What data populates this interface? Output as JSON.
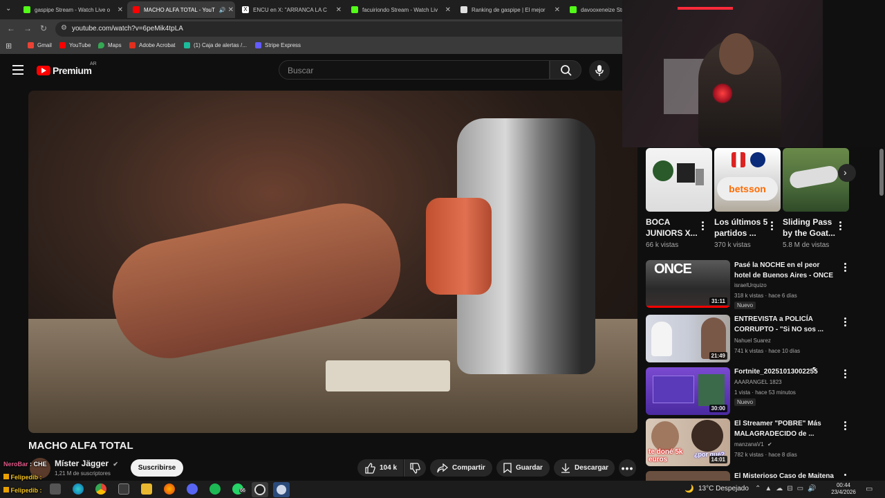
{
  "browser": {
    "tabs": [
      {
        "label": "gaspipe Stream - Watch Live o",
        "color": "#53fc18",
        "active": false
      },
      {
        "label": "MACHO ALFA TOTAL - YouT",
        "color": "#ff0000",
        "active": true
      },
      {
        "label": "ENCU en X: \"ARRANCA LA C",
        "color": "#ffffff",
        "active": false
      },
      {
        "label": "facuiriondo Stream - Watch Liv",
        "color": "#53fc18",
        "active": false
      },
      {
        "label": "Ranking de gaspipe | El mejor",
        "color": "#e0e0e0",
        "active": false
      },
      {
        "label": "davooxeneize Str",
        "color": "#53fc18",
        "active": false
      }
    ],
    "url": "youtube.com/watch?v=6peMik4tpLA",
    "bookmarks": [
      {
        "label": "Gmail",
        "color": "#ea4335"
      },
      {
        "label": "YouTube",
        "color": "#ff0000"
      },
      {
        "label": "Maps",
        "color": "#34a853"
      },
      {
        "label": "Adobe Acrobat",
        "color": "#e02f1e"
      },
      {
        "label": "(1) Caja de alertas /...",
        "color": "#1bbc9b"
      },
      {
        "label": "Stripe Express",
        "color": "#635bff"
      }
    ]
  },
  "youtube": {
    "logo_text": "Premium",
    "region": "AR",
    "search_placeholder": "Buscar"
  },
  "video": {
    "title": "MACHO ALFA TOTAL",
    "channel": "Míster Jägger",
    "subscribers": "1,21 M de suscriptores",
    "subscribe_label": "Suscribirse",
    "likes": "104 k",
    "share_label": "Compartir",
    "save_label": "Guardar",
    "download_label": "Descargar"
  },
  "shorts": [
    {
      "title": "BOCA JUNIORS X...",
      "views": "66 k vistas"
    },
    {
      "title": "Los últimos 5 partidos ...",
      "views": "370 k vistas",
      "thumb_text": "betsson"
    },
    {
      "title": "Sliding Pass by the Goat...",
      "views": "5.8 M de vistas"
    }
  ],
  "recommendations": [
    {
      "title": "Pasé la NOCHE en el peor hotel de Buenos Aires - ONCE",
      "channel": "israelUrquizo",
      "meta": "318 k vistas · hace 6 días",
      "duration": "31:11",
      "badge": "Nuevo",
      "thumb_text": "ONCE"
    },
    {
      "title": "ENTREVISTA a POLICÍA CORRUPTO - \"Si NO sos ...",
      "channel": "Nahuel Suarez",
      "meta": "741 k vistas · hace 10 días",
      "duration": "21:49",
      "badge": ""
    },
    {
      "title": "Fortnite_20251013002255",
      "channel": "AAARANGEL 1823",
      "meta": "1 vista · hace 53 minutos",
      "duration": "30:00",
      "badge": "Nuevo"
    },
    {
      "title": "El Streamer \"POBRE\" Más MALAGRADECIDO de ...",
      "channel": "manzanaV1",
      "meta": "782 k vistas · hace 8 días",
      "duration": "14:01",
      "badge": "",
      "thumb_text": "te doné 5k euros",
      "thumb_text2": "¿por qué?"
    },
    {
      "title": "El Misterioso Caso de Maitena",
      "channel": "",
      "meta": "",
      "duration": "",
      "badge": ""
    }
  ],
  "chat": [
    {
      "user": "NeroBar",
      "text": "CHE",
      "color": "#e05a8a"
    },
    {
      "user": "Felipedib :",
      "text": "",
      "color": "#f0c020"
    },
    {
      "user": "Felipedib :",
      "text": "",
      "color": "#f0c020"
    }
  ],
  "taskbar": {
    "weather": "13°C  Despejado",
    "time": "00:44",
    "date": "23/4/2026",
    "whatsapp_badge": "66"
  }
}
